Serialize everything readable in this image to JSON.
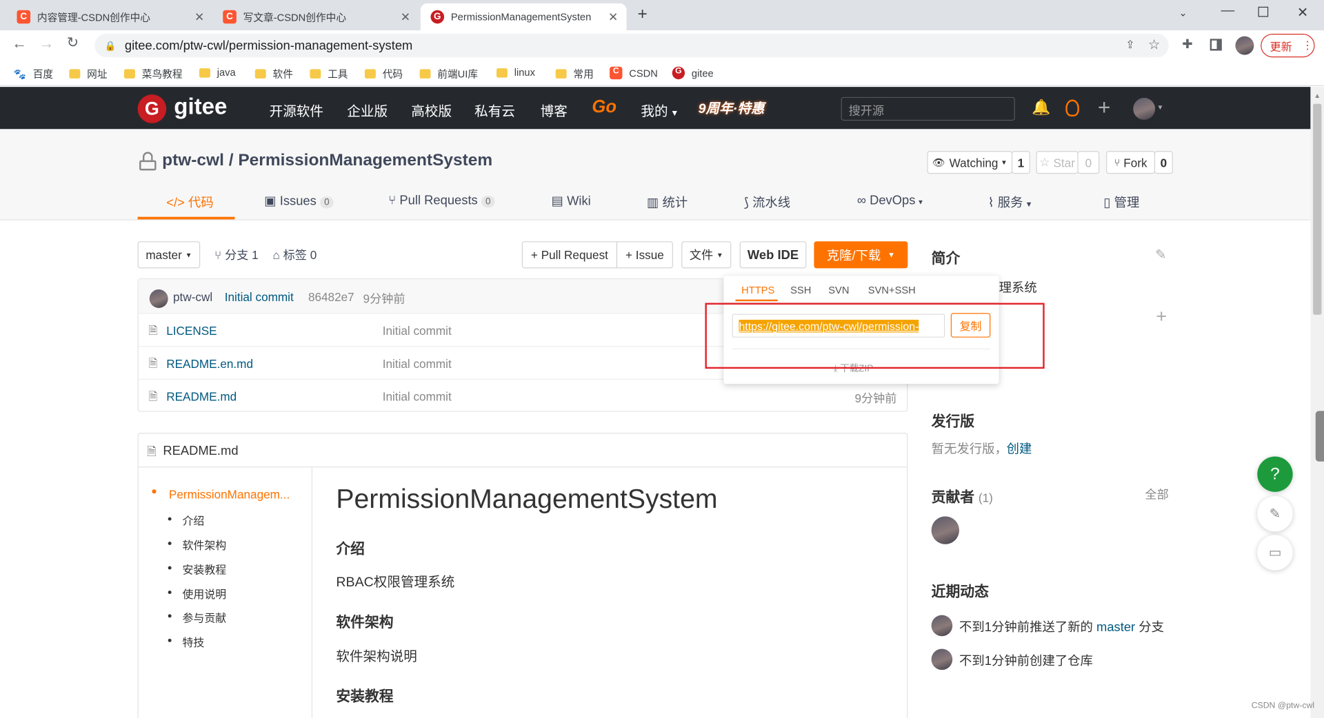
{
  "browser": {
    "tabs": [
      {
        "title": "内容管理-CSDN创作中心",
        "favicon": "C"
      },
      {
        "title": "写文章-CSDN创作中心",
        "favicon": "C"
      },
      {
        "title": "PermissionManagementSysten",
        "favicon": "G"
      }
    ],
    "url": "gitee.com/ptw-cwl/permission-management-system",
    "update_label": "更新",
    "bookmarks": [
      "百度",
      "网址",
      "菜鸟教程",
      "java",
      "软件",
      "工具",
      "代码",
      "前端UI库",
      "linux",
      "常用",
      "CSDN",
      "gitee"
    ]
  },
  "gitee_nav": {
    "logo": "gitee",
    "items": [
      "开源软件",
      "企业版",
      "高校版",
      "私有云",
      "博客",
      "Go",
      "我的"
    ],
    "promo": "9周年·特惠",
    "search_placeholder": "搜开源"
  },
  "repo": {
    "owner": "ptw-cwl",
    "separator": "/",
    "name": "PermissionManagementSystem",
    "watch_label": "Watching",
    "watch_count": "1",
    "star_label": "Star",
    "star_count": "0",
    "fork_label": "Fork",
    "fork_count": "0",
    "tabs": [
      {
        "label": "代码",
        "icon": "code-icon"
      },
      {
        "label": "Issues",
        "badge": "0",
        "icon": "issues-icon"
      },
      {
        "label": "Pull Requests",
        "badge": "0",
        "icon": "pr-icon"
      },
      {
        "label": "Wiki",
        "icon": "wiki-icon"
      },
      {
        "label": "统计",
        "icon": "stats-icon"
      },
      {
        "label": "流水线",
        "icon": "pipeline-icon"
      },
      {
        "label": "DevOps",
        "icon": "devops-icon"
      },
      {
        "label": "服务",
        "icon": "service-icon"
      },
      {
        "label": "管理",
        "icon": "manage-icon"
      }
    ]
  },
  "toolbar": {
    "branch": "master",
    "branches_label": "分支 1",
    "tags_label": "标签 0",
    "pr_label": "+ Pull Request",
    "issue_label": "+ Issue",
    "files_label": "文件",
    "webide_label": "Web IDE",
    "clone_label": "克隆/下载"
  },
  "commit": {
    "author": "ptw-cwl",
    "message": "Initial commit",
    "hash": "86482e7",
    "time": "9分钟前"
  },
  "files": [
    {
      "name": "LICENSE",
      "message": "Initial commit",
      "time": ""
    },
    {
      "name": "README.en.md",
      "message": "Initial commit",
      "time": ""
    },
    {
      "name": "README.md",
      "message": "Initial commit",
      "time": "9分钟前"
    }
  ],
  "clone_popup": {
    "tabs": [
      "HTTPS",
      "SSH",
      "SVN",
      "SVN+SSH"
    ],
    "url": "https://gitee.com/ptw-cwl/permission-",
    "copy_label": "复制",
    "download_label": "下载ZIP"
  },
  "readme": {
    "filename": "README.md",
    "toc": [
      "PermissionManagem...",
      "介绍",
      "软件架构",
      "安装教程",
      "使用说明",
      "参与贡献",
      "特技"
    ],
    "title": "PermissionManagementSystem",
    "h_intro": "介绍",
    "intro_text": "RBAC权限管理系统",
    "h_arch": "软件架构",
    "arch_text": "软件架构说明",
    "h_install": "安装教程"
  },
  "sidebar": {
    "intro_title": "简介",
    "intro_tail": "理系统",
    "release_title": "发行版",
    "no_release": "暂无发行版，",
    "create_link": "创建",
    "contrib_title": "贡献者",
    "contrib_count": "(1)",
    "all_label": "全部",
    "activity_title": "近期动态",
    "act1_pre": "不到1分钟前推送了新的",
    "act1_branch": "master",
    "act1_post": "分支",
    "act2": "不到1分钟前创建了仓库"
  },
  "watermark": "CSDN @ptw-cwl",
  "colors": {
    "accent": "#fe7300",
    "nav_bg": "#25292e",
    "link": "#005980",
    "highlight_border": "#e3242b"
  }
}
